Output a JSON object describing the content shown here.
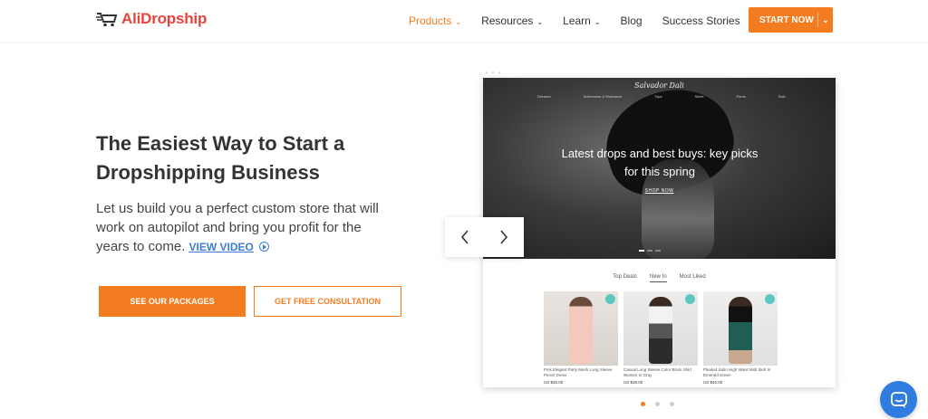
{
  "header": {
    "logo_text": "AliDropship",
    "nav": [
      {
        "label": "Products",
        "has_caret": true,
        "active": true
      },
      {
        "label": "Resources",
        "has_caret": true,
        "active": false
      },
      {
        "label": "Learn",
        "has_caret": true,
        "active": false
      },
      {
        "label": "Blog",
        "has_caret": false,
        "active": false
      },
      {
        "label": "Success Stories",
        "has_caret": false,
        "active": false
      }
    ],
    "cta_label": "START NOW",
    "accent_color": "#f47c20"
  },
  "hero": {
    "title": "The Easiest Way to Start a Dropshipping Business",
    "body": "Let us build you a perfect custom store that will work on autopilot and bring you profit for the years to come.",
    "view_video_label": "VIEW VIDEO",
    "packages_button": "SEE OUR PACKAGES",
    "consultation_button": "GET FREE CONSULTATION"
  },
  "preview": {
    "store_brand": "Salvador Dali",
    "menu": [
      "Dresses",
      "Activewear & Workwear",
      "Tops",
      "Skirts",
      "Pants",
      "Sale"
    ],
    "promo_text": "Latest drops and best buys: key picks for this spring",
    "shop_now": "SHOP NOW",
    "tabs": [
      {
        "label": "Top Deals",
        "active": false
      },
      {
        "label": "New In",
        "active": true
      },
      {
        "label": "Most Liked",
        "active": false
      }
    ],
    "products": [
      {
        "name": "Pink Elegant Party Mesh Long Sleeve Pencil Dress",
        "price": "US $48.00"
      },
      {
        "name": "Casual Long Sleeve Color Block Shirt Women In Gray",
        "price": "US $38.00"
      },
      {
        "name": "Pleated Satin High Waist Midi Skirt In Emerald Green",
        "price": "US $40.00"
      }
    ]
  },
  "carousel": {
    "dot_count": 3,
    "active_index": 0
  },
  "chat": {
    "icon": "chat-icon",
    "color": "#2f7de1"
  }
}
